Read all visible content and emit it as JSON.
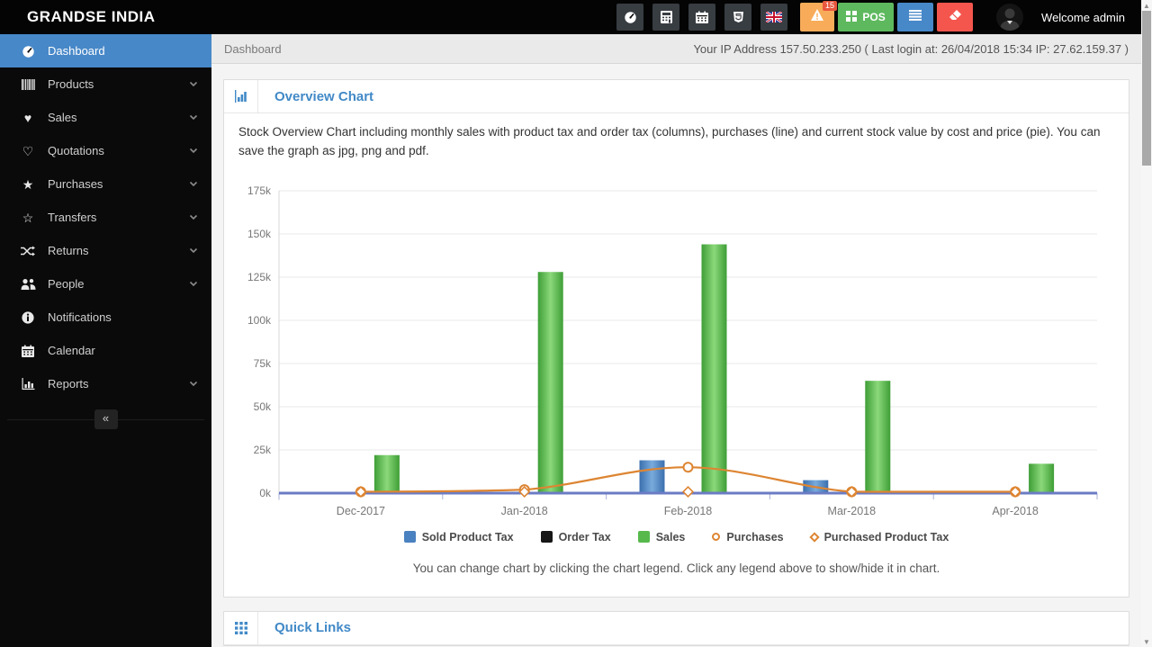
{
  "topbar": {
    "logo": "GRANDSE INDIA",
    "welcome": "Welcome admin",
    "dark_buttons": [
      {
        "icon": "gauge-icon"
      },
      {
        "icon": "calculator-icon"
      },
      {
        "icon": "calendar-icon"
      },
      {
        "icon": "css3-icon"
      },
      {
        "icon": "uk-flag-icon"
      }
    ],
    "alerts_badge": "15",
    "pos_label": "POS"
  },
  "sidebar": {
    "items": [
      {
        "label": "Dashboard",
        "icon": "gauge-icon",
        "has_children": false,
        "active": true
      },
      {
        "label": "Products",
        "icon": "barcode-icon",
        "has_children": true,
        "active": false
      },
      {
        "label": "Sales",
        "icon": "heart-icon",
        "has_children": true,
        "active": false
      },
      {
        "label": "Quotations",
        "icon": "heart-o-icon",
        "has_children": true,
        "active": false
      },
      {
        "label": "Purchases",
        "icon": "star-icon",
        "has_children": true,
        "active": false
      },
      {
        "label": "Transfers",
        "icon": "star-o-icon",
        "has_children": true,
        "active": false
      },
      {
        "label": "Returns",
        "icon": "shuffle-icon",
        "has_children": true,
        "active": false
      },
      {
        "label": "People",
        "icon": "users-icon",
        "has_children": true,
        "active": false
      },
      {
        "label": "Notifications",
        "icon": "info-icon",
        "has_children": false,
        "active": false
      },
      {
        "label": "Calendar",
        "icon": "calendar-icon",
        "has_children": false,
        "active": false
      },
      {
        "label": "Reports",
        "icon": "bar-chart-icon",
        "has_children": true,
        "active": false
      }
    ],
    "collapse_label": "«"
  },
  "breadcrumb": {
    "title": "Dashboard",
    "ip_info": "Your IP Address 157.50.233.250 ( Last login at: 26/04/2018 15:34 IP: 27.62.159.37 )"
  },
  "overview_panel": {
    "title": "Overview Chart",
    "description": "Stock Overview Chart including monthly sales with product tax and order tax (columns), purchases (line) and current stock value by cost and price (pie). You can save the graph as jpg, png and pdf.",
    "footer_note": "You can change chart by clicking the chart legend. Click any legend above to show/hide it in chart."
  },
  "quick_links_panel": {
    "title": "Quick Links"
  },
  "chart_data": {
    "type": "bar",
    "subtype": "columns+lines",
    "categories": [
      "Dec-2017",
      "Jan-2018",
      "Feb-2018",
      "Mar-2018",
      "Apr-2018"
    ],
    "series": [
      {
        "name": "Sold Product Tax",
        "render": "column",
        "color": "#4a81c0",
        "values": [
          0,
          0,
          19000,
          7500,
          0
        ]
      },
      {
        "name": "Order Tax",
        "render": "column",
        "color": "#161616",
        "values": [
          0,
          0,
          0,
          0,
          0
        ]
      },
      {
        "name": "Sales",
        "render": "column",
        "color": "#57b94c",
        "values": [
          22000,
          128000,
          144000,
          65000,
          17000
        ]
      },
      {
        "name": "Purchases",
        "render": "line",
        "marker": "circle",
        "color": "#dd8532",
        "values": [
          0,
          2000,
          15000,
          0,
          0
        ]
      },
      {
        "name": "Purchased Product Tax",
        "render": "line",
        "marker": "diamond",
        "color": "#dd8532",
        "values": [
          0,
          0,
          0,
          0,
          0
        ]
      }
    ],
    "ylim": [
      0,
      175000
    ],
    "ytick_labels": [
      "0k",
      "25k",
      "50k",
      "75k",
      "100k",
      "125k",
      "150k",
      "175k"
    ],
    "grid": true,
    "legend_position": "bottom"
  },
  "colors": {
    "accent_blue": "#4189c7",
    "sidebar_active": "#4788c8",
    "warn_orange": "#f8ac59",
    "pos_green": "#5eb95e",
    "danger_red": "#f4564e",
    "badge_red": "#e9573f",
    "axis_line": "#6b7cc4",
    "line_orange": "#dd8532"
  }
}
